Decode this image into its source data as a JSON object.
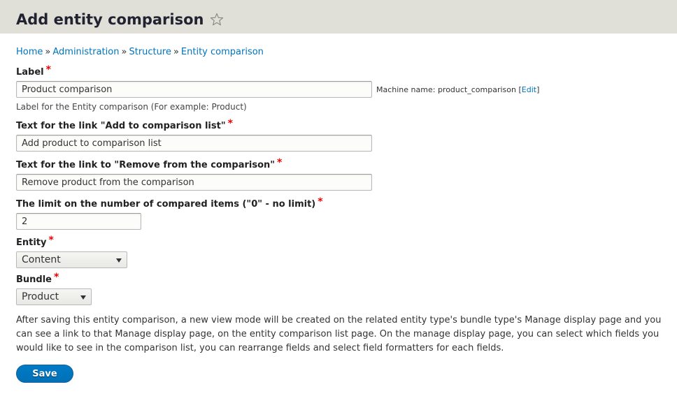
{
  "header": {
    "title": "Add entity comparison",
    "shortcut_icon": "star-outline-icon"
  },
  "breadcrumb": {
    "items": [
      "Home",
      "Administration",
      "Structure",
      "Entity comparison"
    ],
    "separator": "»"
  },
  "form": {
    "label_field": {
      "label": "Label",
      "required_mark": "*",
      "value": "Product comparison",
      "machine_name_prefix": "Machine name: product_comparison",
      "machine_name_edit_open": "[",
      "machine_name_edit": "Edit",
      "machine_name_edit_close": "]",
      "description": "Label for the Entity comparison (For example: Product)"
    },
    "add_link_field": {
      "label": "Text for the link \"Add to comparison list\"",
      "required_mark": "*",
      "value": "Add product to comparison list"
    },
    "remove_link_field": {
      "label": "Text for the link to \"Remove from the comparison\"",
      "required_mark": "*",
      "value": "Remove product from the comparison"
    },
    "limit_field": {
      "label": "The limit on the number of compared items (\"0\" - no limit)",
      "required_mark": "*",
      "value": "2"
    },
    "entity_field": {
      "label": "Entity",
      "required_mark": "*",
      "selected": "Content"
    },
    "bundle_field": {
      "label": "Bundle",
      "required_mark": "*",
      "selected": "Product"
    },
    "info_text": "After saving this entity comparison, a new view mode will be created on the related entity type's bundle type's Manage display page and you can see a link to that Manage display page, on the entity comparison list page. On the manage display page, you can select which fields you would like to see in the comparison list, you can rearrange fields and select field formatters for each fields.",
    "save_label": "Save"
  },
  "colors": {
    "header_bg": "#e0e0d8",
    "link": "#0074bd",
    "required": "#e00000",
    "button": "#0074bd"
  }
}
